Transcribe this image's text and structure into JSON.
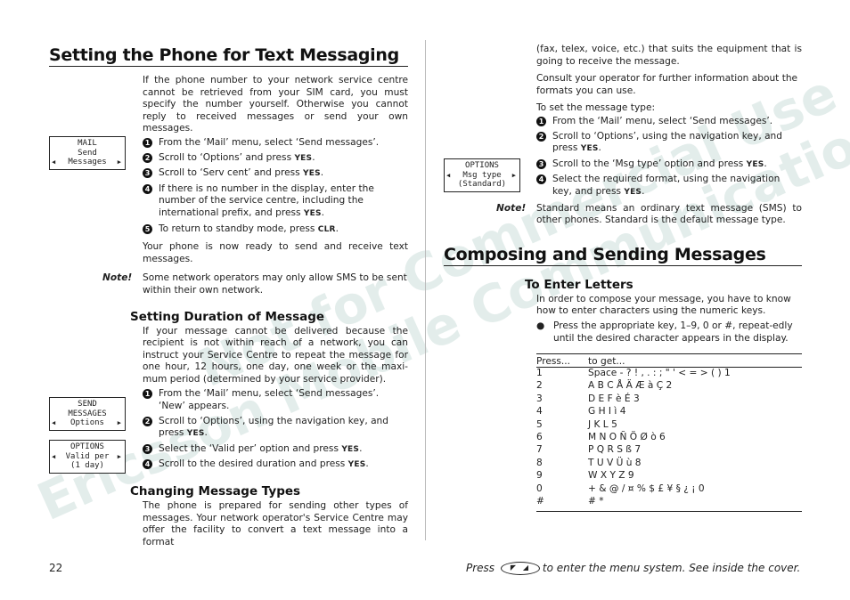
{
  "left": {
    "title": "Setting the Phone for Text Messaging",
    "intro": "If the phone number to your network service centre cannot be retrieved from your SIM card, you must specify the number yourself. Otherwise you cannot reply to received messages or send your own messages.",
    "lcd1": {
      "line1": "MAIL",
      "line2": "Send",
      "line3": "Messages"
    },
    "steps": [
      {
        "num": "1",
        "text": "From the ‘Mail’ menu, select ‘Send messages’.",
        "key": ""
      },
      {
        "num": "2",
        "text": "Scroll to ‘Options’ and press ",
        "key": "YES"
      },
      {
        "num": "3",
        "text": "Scroll to ‘Serv cent’ and press ",
        "key": "YES"
      },
      {
        "num": "4",
        "text": "If there is no number in the display, enter the number of the service centre, including the international prefix, and press ",
        "key": "YES"
      },
      {
        "num": "5",
        "text": "To return to standby mode, press ",
        "key": "CLR"
      }
    ],
    "ready": "Your phone is now ready to send and receive text messages.",
    "note_label": "Note!",
    "note": "Some network operators may only allow SMS to be sent within their own network.",
    "duration": {
      "title": "Setting Duration of Message",
      "intro": "If your message cannot be delivered because the recipient is not within reach of a network, you can instruct your Service Centre to repeat the message for one hour, 12 hours, one day, one week or the maxi-mum period (determined by your service provider).",
      "lcd2": {
        "line1": "SEND",
        "line2": "MESSAGES",
        "line3": "Options"
      },
      "lcd3": {
        "line1": "OPTIONS",
        "line2": "Valid per",
        "line3": "(1 day)"
      },
      "steps": [
        {
          "num": "1",
          "text": "From the ‘Mail’ menu, select ‘Send messages’. ‘New’ appears.",
          "key": ""
        },
        {
          "num": "2",
          "text": "Scroll to ‘Options’, using the navigation key, and press ",
          "key": "YES"
        },
        {
          "num": "3",
          "text": "Select the ‘Valid per’ option and press ",
          "key": "YES"
        },
        {
          "num": "4",
          "text": "Scroll to the desired duration and press ",
          "key": "YES"
        }
      ]
    },
    "types": {
      "title": "Changing Message Types",
      "intro": "The phone is prepared for sending other types of messages. Your network operator's Service Centre may offer the facility to convert a text message into a format"
    }
  },
  "right": {
    "cont": "(fax, telex, voice, etc.) that suits the equipment that is going to receive the message.",
    "consult": "Consult your operator for further information about the formats you can use.",
    "set_type": "To set the message type:",
    "lcd4": {
      "line1": "OPTIONS",
      "line2": "Msg type",
      "line3": "(Standard)"
    },
    "steps": [
      {
        "num": "1",
        "text": "From the ‘Mail’ menu, select ‘Send messages’.",
        "key": ""
      },
      {
        "num": "2",
        "text": "Scroll to ‘Options’, using the navigation key, and press ",
        "key": "YES"
      },
      {
        "num": "3",
        "text": "Scroll to the ‘Msg type’ option and press ",
        "key": "YES"
      },
      {
        "num": "4",
        "text": "Select the required format, using the navigation key, and press ",
        "key": "YES"
      }
    ],
    "note_label": "Note!",
    "note": "Standard means an ordinary text message (SMS) to other phones. Standard is the default message type.",
    "composing": {
      "title": "Composing and Sending Messages",
      "sub": "To Enter Letters",
      "intro": "In order to compose your message, you have to know how to enter characters using the numeric keys.",
      "bullet": "Press the appropriate key, 1–9, 0 or #, repeat-edly until the desired character appears in the display.",
      "table": {
        "headers": [
          "Press...",
          "to get..."
        ],
        "rows": [
          [
            "1",
            "Space - ? ! , . : ; \" ' < = > ( ) 1"
          ],
          [
            "2",
            "A B C Å Ä Æ à Ç 2"
          ],
          [
            "3",
            "D E F è É 3"
          ],
          [
            "4",
            "G H I ì 4"
          ],
          [
            "5",
            "J K L 5"
          ],
          [
            "6",
            "M N O Ñ Ö Ø ò 6"
          ],
          [
            "7",
            "P Q R S ß 7"
          ],
          [
            "8",
            "T U V Ü ù 8"
          ],
          [
            "9",
            "W X Y Z 9"
          ],
          [
            "0",
            "+ & @ / ¤ % $ £ ¥ § ¿ ¡ 0"
          ],
          [
            "#",
            "# *"
          ]
        ]
      }
    }
  },
  "footer": {
    "page_number": "22",
    "press": "Press",
    "rest": "to enter the menu system. See inside the cover.",
    "button_icon": "menu-arrows-key"
  },
  "watermark": {
    "line1": "Ericsson Mobile Communications AB",
    "line2": "Not for Commercial Use",
    "color": "#d8e6e3"
  }
}
